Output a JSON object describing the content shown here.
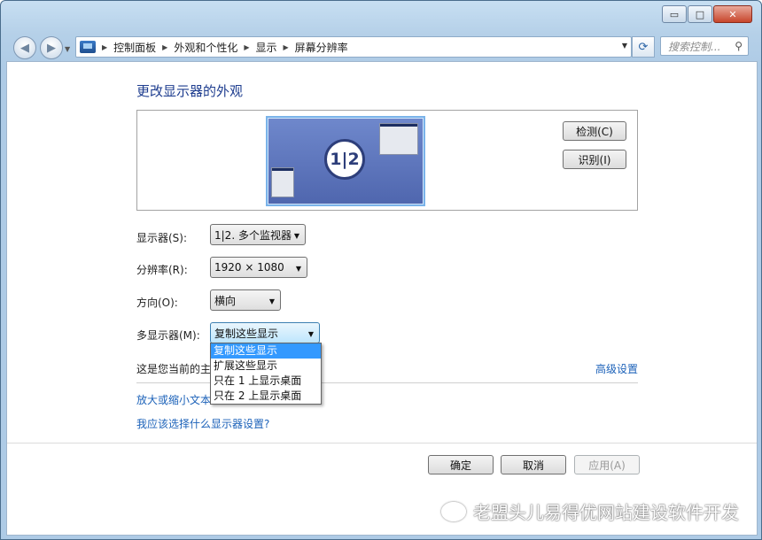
{
  "caption": {
    "minimize": "▭",
    "maximize": "□",
    "close": "✕"
  },
  "nav": {
    "back": "◀",
    "forward": "▶",
    "breadcrumb": [
      "控制面板",
      "外观和个性化",
      "显示",
      "屏幕分辨率"
    ],
    "search_placeholder": "搜索控制...",
    "refresh": "⟳"
  },
  "page": {
    "title": "更改显示器的外观"
  },
  "preview": {
    "monitor_label": "1|2",
    "detect_button": "检测(C)",
    "identify_button": "识别(I)"
  },
  "settings": {
    "display_label": "显示器(S):",
    "display_value": "1|2. 多个监视器",
    "resolution_label": "分辨率(R):",
    "resolution_value": "1920 × 1080",
    "orientation_label": "方向(O):",
    "orientation_value": "横向",
    "multi_label": "多显示器(M):",
    "multi_value": "复制这些显示",
    "multi_options": [
      "复制这些显示",
      "扩展这些显示",
      "只在 1 上显示桌面",
      "只在 2 上显示桌面"
    ]
  },
  "info": {
    "current_text": "这是您当前的主",
    "advanced_link": "高级设置",
    "zoom_link": "放大或缩小文本",
    "help_link": "我应该选择什么显示器设置?"
  },
  "footer": {
    "ok": "确定",
    "cancel": "取消",
    "apply": "应用(A)"
  },
  "watermark": "老盟头儿易得优网站建设软件开发"
}
